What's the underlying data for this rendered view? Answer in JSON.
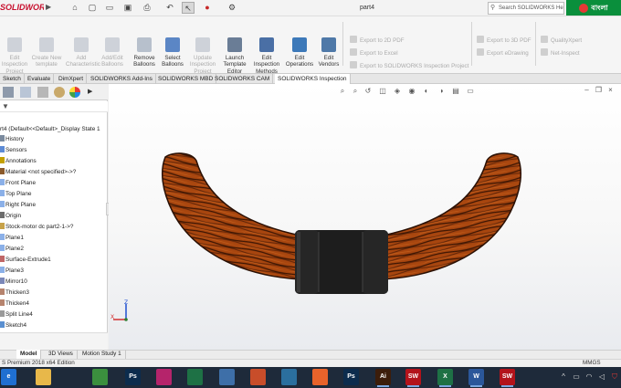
{
  "app": {
    "logo_text": "SOLIDWORKS",
    "document_title": "part4",
    "search_placeholder": "Search SOLIDWORKS Help",
    "lang_badge_text": "বাংলা",
    "brand_color": "#c8102e",
    "quick_access_icons": [
      "home-icon",
      "new-document-icon",
      "open-file-icon",
      "save-icon",
      "print-icon",
      "undo-icon",
      "select-arrow-icon",
      "traffic-light-icon",
      "options-gear-icon"
    ]
  },
  "command_manager": {
    "buttons": [
      {
        "label": "Edit Inspection Project",
        "enabled": false,
        "icon": "edit-project-icon"
      },
      {
        "label": "Create New template",
        "enabled": false,
        "icon": "new-template-icon"
      },
      {
        "label": "Add Characteristic",
        "enabled": false,
        "icon": "add-characteristic-icon"
      },
      {
        "label": "Add/Edit Balloons",
        "enabled": false,
        "icon": "balloon-edit-icon"
      },
      {
        "label": "Remove Balloons",
        "enabled": true,
        "icon": "remove-balloon-icon"
      },
      {
        "label": "Select Balloons",
        "enabled": true,
        "icon": "select-balloon-icon"
      },
      {
        "label": "Update Inspection Project",
        "enabled": false,
        "icon": "update-project-icon"
      },
      {
        "label": "Launch Template Editor",
        "enabled": true,
        "icon": "template-editor-icon"
      },
      {
        "label": "Edit Inspection Methods",
        "enabled": true,
        "icon": "inspection-methods-icon"
      },
      {
        "label": "Edit Operations",
        "enabled": true,
        "icon": "operations-icon"
      },
      {
        "label": "Edit Vendors",
        "enabled": true,
        "icon": "vendors-icon"
      }
    ],
    "export_left": [
      "Export to 2D PDF",
      "Export to Excel",
      "Export to SOLIDWORKS Inspection Project"
    ],
    "export_right": [
      "Export to 3D PDF",
      "Export eDrawing"
    ],
    "quality": [
      "QualityXpert",
      "Net-Inspect"
    ]
  },
  "tabs": [
    {
      "label": "Sketch",
      "active": false
    },
    {
      "label": "Evaluate",
      "active": false
    },
    {
      "label": "DimXpert",
      "active": false
    },
    {
      "label": "SOLIDWORKS Add-Ins",
      "active": false
    },
    {
      "label": "SOLIDWORKS MBD",
      "active": false
    },
    {
      "label": "SOLIDWORKS CAM",
      "active": false
    },
    {
      "label": "SOLIDWORKS Inspection",
      "active": true
    }
  ],
  "feature_tree": {
    "root": "rt4  (Default<<Default>_Display State 1",
    "items": [
      {
        "label": "History",
        "icon": "history-icon"
      },
      {
        "label": "Sensors",
        "icon": "sensor-icon"
      },
      {
        "label": "Annotations",
        "icon": "annotation-icon"
      },
      {
        "label": "Material <not specified>->?",
        "icon": "material-icon"
      },
      {
        "label": "Front Plane",
        "icon": "plane-icon"
      },
      {
        "label": "Top Plane",
        "icon": "plane-icon"
      },
      {
        "label": "Right Plane",
        "icon": "plane-icon"
      },
      {
        "label": "Origin",
        "icon": "origin-icon"
      },
      {
        "label": "Stock-motor dc part2-1->?",
        "icon": "part-icon"
      },
      {
        "label": "Plane1",
        "icon": "plane-icon"
      },
      {
        "label": "Plane2",
        "icon": "plane-icon"
      },
      {
        "label": "Surface-Extrude1",
        "icon": "surface-icon"
      },
      {
        "label": "Plane3",
        "icon": "plane-icon"
      },
      {
        "label": "Mirror10",
        "icon": "mirror-icon"
      },
      {
        "label": "Thicken3",
        "icon": "thicken-icon"
      },
      {
        "label": "Thicken4",
        "icon": "thicken-icon"
      },
      {
        "label": "Split Line4",
        "icon": "split-line-icon"
      },
      {
        "label": "Sketch4",
        "icon": "sketch-icon"
      }
    ]
  },
  "bottom_tabs": [
    {
      "label": "Model",
      "active": true
    },
    {
      "label": "3D Views",
      "active": false
    },
    {
      "label": "Motion Study 1",
      "active": false
    }
  ],
  "status": {
    "text": "S Premium 2018 x64 Edition",
    "units": "MMGS"
  },
  "taskbar": {
    "apps": [
      {
        "name": "edge",
        "label": "e",
        "color": "#1f6fd1"
      },
      {
        "name": "file-explorer",
        "label": "",
        "color": "#e8b84a"
      },
      {
        "name": "chrome",
        "label": "",
        "color": "#3b8f3e"
      },
      {
        "name": "photoshop",
        "label": "Ps",
        "color": "#0c2c4d"
      },
      {
        "name": "media",
        "label": "",
        "color": "#b5246b"
      },
      {
        "name": "excel-template",
        "label": "",
        "color": "#1e7145"
      },
      {
        "name": "images",
        "label": "",
        "color": "#3e6fa8"
      },
      {
        "name": "powerpoint",
        "label": "",
        "color": "#c84d2a"
      },
      {
        "name": "app-blue",
        "label": "",
        "color": "#2b6f9e"
      },
      {
        "name": "firefox",
        "label": "",
        "color": "#e8632b"
      },
      {
        "name": "photoshop-2",
        "label": "Ps",
        "color": "#0c2c4d"
      },
      {
        "name": "illustrator",
        "label": "Ai",
        "color": "#3c1d0a"
      },
      {
        "name": "solidworks-2016",
        "label": "SW",
        "color": "#b3131b"
      },
      {
        "name": "excel",
        "label": "X",
        "color": "#1e7145"
      },
      {
        "name": "word",
        "label": "W",
        "color": "#2b579a"
      },
      {
        "name": "solidworks-2018",
        "label": "SW",
        "color": "#b3131b"
      }
    ]
  }
}
